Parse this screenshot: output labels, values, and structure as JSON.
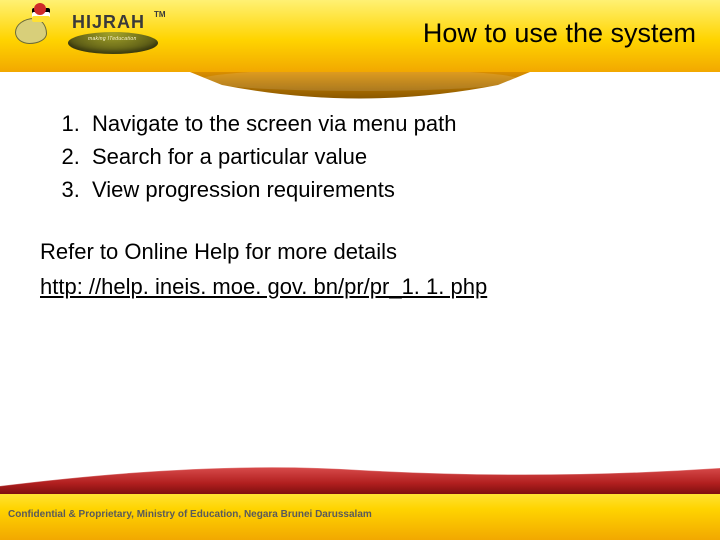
{
  "logo": {
    "wordmark": "HIJRAH",
    "trademark": "TM",
    "tagline": "making ITeducation"
  },
  "title": "How to use the system",
  "steps": [
    "Navigate to the screen via menu path",
    "Search for a particular value",
    "View progression requirements"
  ],
  "refer_text": "Refer to Online Help for more details",
  "help_url_display": "http: //help. ineis. moe. gov. bn/pr/pr_1. 1. php",
  "footer_text": "Confidential & Proprietary, Ministry of Education, Negara Brunei Darussalam"
}
